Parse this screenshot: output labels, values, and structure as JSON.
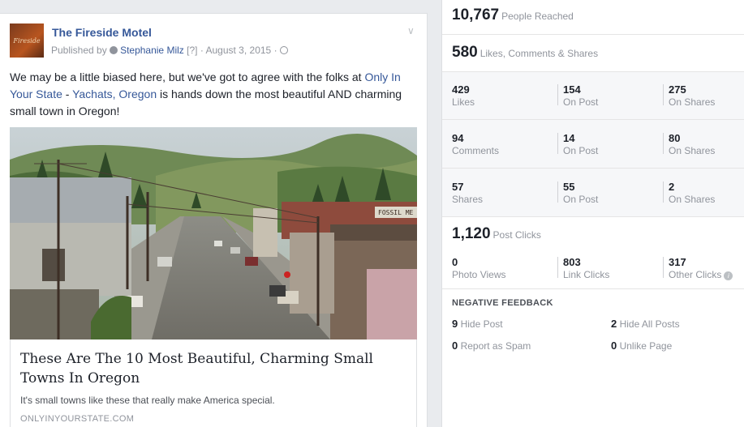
{
  "post": {
    "page_name": "The Fireside Motel",
    "avatar_text": "Fireside",
    "published_by_label": "Published by",
    "author": "Stephanie Milz",
    "author_tag": "[?]",
    "date": "August 3, 2015",
    "meta_sep": "·",
    "text_before": "We may be a little biased here, but we've got to agree with the folks at ",
    "link1": "Only In Your State",
    "dash": " - ",
    "link2": "Yachats, Oregon",
    "text_after": " is hands down the most beautiful AND charming small town in Oregon!",
    "sign_text": "FOSSIL ME",
    "link_title": "These Are The 10 Most Beautiful, Charming Small Towns In Oregon",
    "link_desc": "It's small towns like these that really make America special.",
    "link_domain": "ONLYINYOURSTATE.COM"
  },
  "stats": {
    "reached": {
      "value": "10,767",
      "label": "People Reached"
    },
    "engagement": {
      "value": "580",
      "label": "Likes, Comments & Shares"
    },
    "rows": [
      [
        {
          "n": "429",
          "l": "Likes"
        },
        {
          "n": "154",
          "l": "On Post"
        },
        {
          "n": "275",
          "l": "On Shares"
        }
      ],
      [
        {
          "n": "94",
          "l": "Comments"
        },
        {
          "n": "14",
          "l": "On Post"
        },
        {
          "n": "80",
          "l": "On Shares"
        }
      ],
      [
        {
          "n": "57",
          "l": "Shares"
        },
        {
          "n": "55",
          "l": "On Post"
        },
        {
          "n": "2",
          "l": "On Shares"
        }
      ]
    ],
    "clicks": {
      "value": "1,120",
      "label": "Post Clicks"
    },
    "click_cells": [
      {
        "n": "0",
        "l": "Photo Views"
      },
      {
        "n": "803",
        "l": "Link Clicks"
      },
      {
        "n": "317",
        "l": "Other Clicks"
      }
    ],
    "info_glyph": "i",
    "negative_title": "NEGATIVE FEEDBACK",
    "negative": [
      {
        "n": "9",
        "l": "Hide Post"
      },
      {
        "n": "2",
        "l": "Hide All Posts"
      },
      {
        "n": "0",
        "l": "Report as Spam"
      },
      {
        "n": "0",
        "l": "Unlike Page"
      }
    ]
  },
  "colors": {
    "link": "#365899",
    "muted": "#90949c",
    "panel_bg": "#f6f7f9"
  },
  "icons": [
    "gear-icon",
    "globe-icon",
    "chevron-down-icon",
    "info-icon"
  ]
}
